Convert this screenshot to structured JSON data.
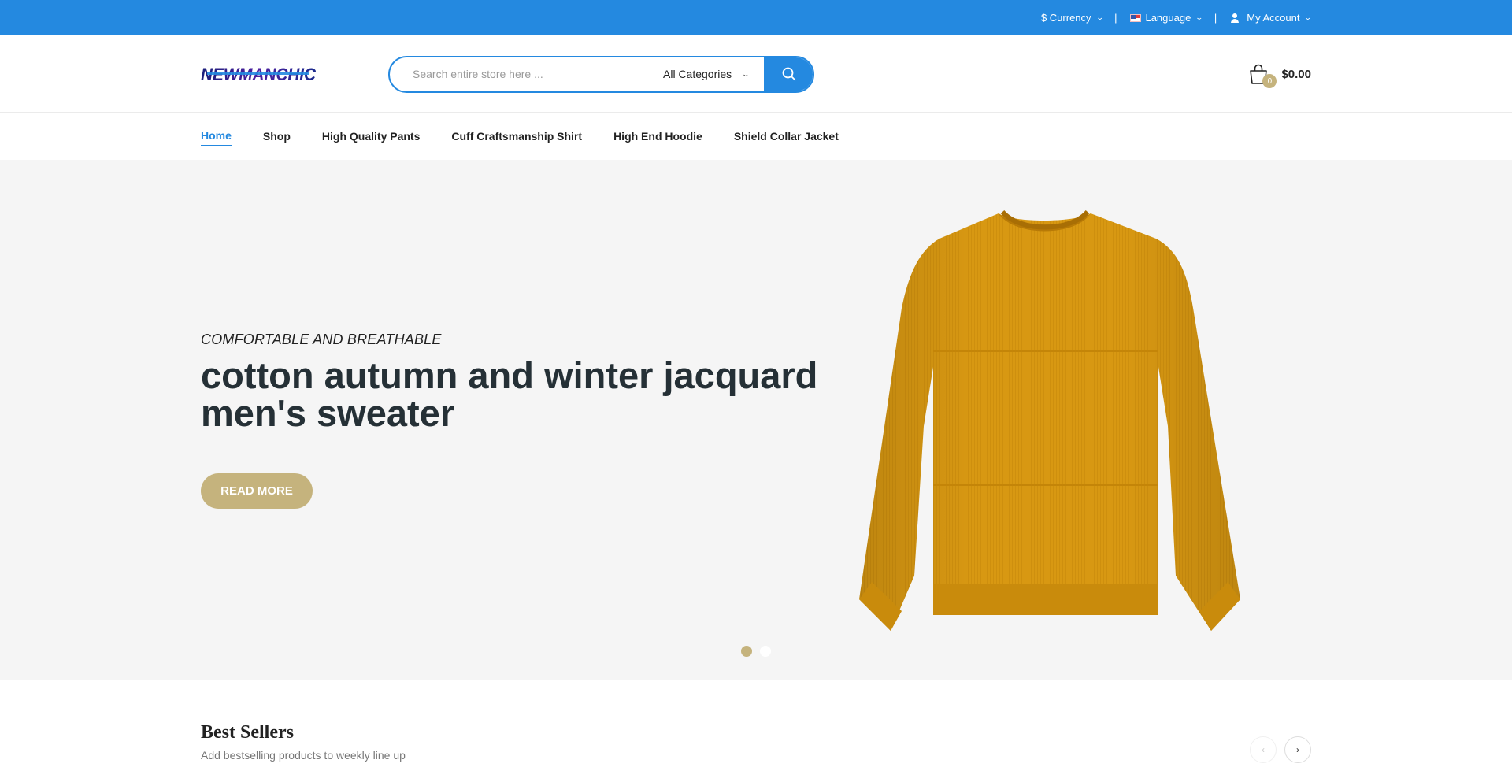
{
  "topbar": {
    "currency_label": "$ Currency",
    "language_label": "Language",
    "account_label": "My Account",
    "separator": "|"
  },
  "header": {
    "logo_text": "NEWMANCHIC",
    "search_placeholder": "Search entire store here ...",
    "category_label": "All Categories",
    "cart_count": "0",
    "cart_total": "$0.00"
  },
  "nav": {
    "items": [
      {
        "label": "Home"
      },
      {
        "label": "Shop"
      },
      {
        "label": "High Quality Pants"
      },
      {
        "label": "Cuff Craftsmanship Shirt"
      },
      {
        "label": "High End Hoodie"
      },
      {
        "label": "Shield Collar Jacket"
      }
    ]
  },
  "hero": {
    "subtitle": "COMFORTABLE AND BREATHABLE",
    "title": "cotton autumn and winter jacquard men's sweater",
    "button_label": "READ MORE",
    "active_slide": 1,
    "slide_count": 2
  },
  "best_sellers": {
    "title": "Best Sellers",
    "subtitle": "Add bestselling products to weekly line up",
    "prev_icon": "‹",
    "next_icon": "›"
  },
  "colors": {
    "primary": "#2489e0",
    "accent": "#c5b37d",
    "hero_bg": "#f5f5f5",
    "product": "#d89812"
  },
  "icons": {
    "search": "search-icon",
    "cart": "shopping-bag-icon",
    "user": "user-icon",
    "flag": "flag-icon"
  }
}
